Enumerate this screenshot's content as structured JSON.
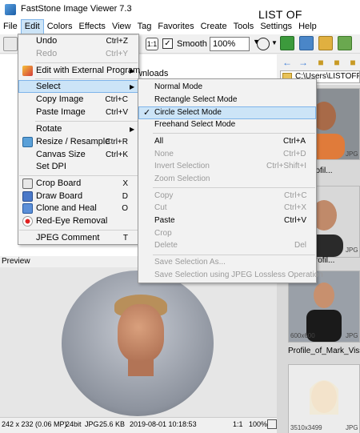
{
  "window": {
    "title": "FastStone Image Viewer 7.3",
    "watermark": "LIST OF FREEWARE"
  },
  "menubar": [
    "File",
    "Edit",
    "Colors",
    "Effects",
    "View",
    "Tag",
    "Favorites",
    "Create",
    "Tools",
    "Settings",
    "Help"
  ],
  "toolbar": {
    "smooth_label": "Smooth",
    "smooth_checked": "✓",
    "zoom_value": "100%",
    "fit_label": "1:1"
  },
  "tree": {
    "partial_text": "wnloads"
  },
  "path": {
    "value": "C:\\Users\\LISTOFFREE"
  },
  "edit_menu": {
    "undo": {
      "label": "Undo",
      "shortcut": "Ctrl+Z"
    },
    "redo": {
      "label": "Redo",
      "shortcut": "Ctrl+Y"
    },
    "edit_external": {
      "label": "Edit with External Program"
    },
    "select": {
      "label": "Select"
    },
    "copy_image": {
      "label": "Copy Image",
      "shortcut": "Ctrl+C"
    },
    "paste_image": {
      "label": "Paste Image",
      "shortcut": "Ctrl+V"
    },
    "rotate": {
      "label": "Rotate"
    },
    "resize": {
      "label": "Resize / Resample",
      "shortcut": "Ctrl+R"
    },
    "canvas_size": {
      "label": "Canvas Size",
      "shortcut": "Ctrl+K"
    },
    "set_dpi": {
      "label": "Set DPI"
    },
    "crop_board": {
      "label": "Crop Board",
      "shortcut": "X"
    },
    "draw_board": {
      "label": "Draw Board",
      "shortcut": "D"
    },
    "clone_heal": {
      "label": "Clone and Heal",
      "shortcut": "O"
    },
    "red_eye": {
      "label": "Red-Eye Removal"
    },
    "jpeg_comment": {
      "label": "JPEG Comment",
      "shortcut": "T"
    }
  },
  "select_menu": {
    "normal": {
      "label": "Normal Mode"
    },
    "rectangle": {
      "label": "Rectangle Select Mode"
    },
    "circle": {
      "label": "Circle Select Mode",
      "check": "✓"
    },
    "freehand": {
      "label": "Freehand Select Mode"
    },
    "all": {
      "label": "All",
      "shortcut": "Ctrl+A"
    },
    "none": {
      "label": "None",
      "shortcut": "Ctrl+D"
    },
    "invert": {
      "label": "Invert Selection",
      "shortcut": "Ctrl+Shift+I"
    },
    "zoom": {
      "label": "Zoom Selection"
    },
    "copy": {
      "label": "Copy",
      "shortcut": "Ctrl+C"
    },
    "cut": {
      "label": "Cut",
      "shortcut": "Ctrl+X"
    },
    "paste": {
      "label": "Paste",
      "shortcut": "Ctrl+V"
    },
    "crop": {
      "label": "Crop"
    },
    "delete": {
      "label": "Delete",
      "shortcut": "Del"
    },
    "save_as": {
      "label": "Save Selection As..."
    },
    "save_lossless": {
      "label": "Save Selection using JPEG Lossless Operation"
    }
  },
  "preview": {
    "label": "Preview"
  },
  "thumbnails": [
    {
      "caption": "hah-_profil...",
      "meta": "JPG"
    },
    {
      "caption": "Flipo_Profil...",
      "meta": "JPG"
    },
    {
      "caption": "Profile_of_Mark_Viss...",
      "size": "600x600",
      "meta": "JPG"
    },
    {
      "caption": "",
      "size": "3510x3499",
      "meta": "JPG"
    }
  ],
  "statusbar": {
    "dimensions": "242 x 232 (0.06 MP)",
    "bitdepth": "24bit",
    "format": "JPG",
    "filesize": "25.6 KB",
    "datetime": "2019-08-01 10:18:53",
    "zoom": "1:1",
    "percent": "100%"
  },
  "colors": {
    "menu_highlight": "#cce4f7",
    "highlight_border": "#7eb4ea"
  }
}
